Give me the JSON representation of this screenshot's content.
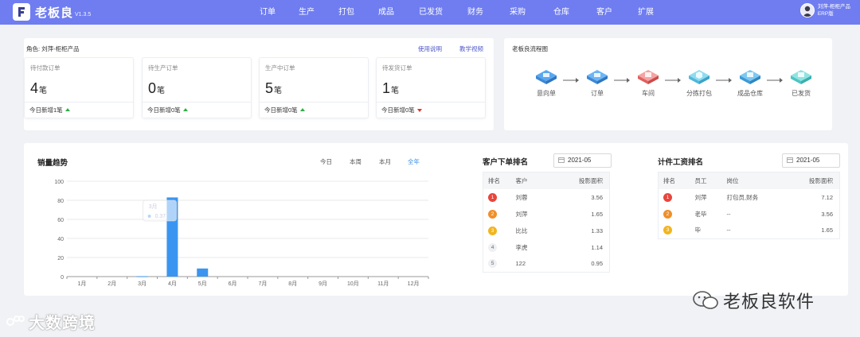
{
  "app": {
    "name": "老板良",
    "version": "V1.3.5",
    "accent": "#6f7df0"
  },
  "nav": [
    {
      "label": "订单"
    },
    {
      "label": "生产"
    },
    {
      "label": "打包"
    },
    {
      "label": "成品"
    },
    {
      "label": "已发货"
    },
    {
      "label": "财务"
    },
    {
      "label": "采购"
    },
    {
      "label": "仓库"
    },
    {
      "label": "客户"
    },
    {
      "label": "扩展"
    }
  ],
  "user": {
    "name": "刘萍-柜柜产品",
    "edition": "ERP版"
  },
  "role": {
    "text": "角色: 刘萍-柜柜产品",
    "help_link": "使用说明",
    "video_link": "教学视频"
  },
  "cards": [
    {
      "title": "待付款订单",
      "value": "4",
      "unit": "笔",
      "today": "今日新增1笔",
      "trend": "up"
    },
    {
      "title": "待生产订单",
      "value": "0",
      "unit": "笔",
      "today": "今日新增0笔",
      "trend": "up"
    },
    {
      "title": "生产中订单",
      "value": "5",
      "unit": "笔",
      "today": "今日新增0笔",
      "trend": "up"
    },
    {
      "title": "待发货订单",
      "value": "1",
      "unit": "笔",
      "today": "今日新增0笔",
      "trend": "down"
    }
  ],
  "flow": {
    "title": "老板良流程图",
    "steps": [
      {
        "label": "意向单",
        "icon": "intent-order-icon",
        "color": "#5aa7f0"
      },
      {
        "label": "订单",
        "icon": "order-icon",
        "color": "#5aa7f0"
      },
      {
        "label": "车间",
        "icon": "workshop-icon",
        "color": "#f06a6a"
      },
      {
        "label": "分拣打包",
        "icon": "packing-icon",
        "color": "#4fc4e8"
      },
      {
        "label": "成品仓库",
        "icon": "warehouse-icon",
        "color": "#4fb3e8"
      },
      {
        "label": "已发货",
        "icon": "shipped-icon",
        "color": "#4fd1d1"
      }
    ]
  },
  "sales": {
    "title": "销量趋势",
    "ranges": [
      "今日",
      "本周",
      "本月",
      "全年"
    ],
    "active_range": "全年",
    "tooltip": {
      "month": "3月",
      "value": "0.37"
    }
  },
  "chart_data": {
    "type": "bar",
    "title": "销量趋势",
    "categories": [
      "1月",
      "2月",
      "3月",
      "4月",
      "5月",
      "6月",
      "7月",
      "8月",
      "9月",
      "10月",
      "11月",
      "12月"
    ],
    "values": [
      0,
      0,
      0.37,
      83,
      8.5,
      0,
      0,
      0,
      0,
      0,
      0,
      0
    ],
    "yticks": [
      "0",
      "20",
      "40",
      "60",
      "80",
      "100"
    ],
    "ylim": [
      0,
      100
    ],
    "grid": true,
    "bar_color": "#3a95f0"
  },
  "customer_rank": {
    "title": "客户下单排名",
    "date": "2021-05",
    "headers": [
      "排名",
      "客户",
      "投影面积"
    ],
    "rows": [
      {
        "rank": "1",
        "name": "刘蓉",
        "value": "3.56"
      },
      {
        "rank": "2",
        "name": "刘萍",
        "value": "1.65"
      },
      {
        "rank": "3",
        "name": "比比",
        "value": "1.33"
      },
      {
        "rank": "4",
        "name": "李虎",
        "value": "1.14"
      },
      {
        "rank": "5",
        "name": "122",
        "value": "0.95"
      }
    ]
  },
  "wage_rank": {
    "title": "计件工资排名",
    "date": "2021-05",
    "headers": [
      "排名",
      "员工",
      "岗位",
      "投影面积"
    ],
    "rows": [
      {
        "rank": "1",
        "name": "刘萍",
        "post": "打包员,财务",
        "value": "7.12"
      },
      {
        "rank": "2",
        "name": "老毕",
        "post": "--",
        "value": "3.56"
      },
      {
        "rank": "3",
        "name": "毕",
        "post": "--",
        "value": "1.65"
      }
    ]
  },
  "watermarks": {
    "left": "大数跨境",
    "right": "老板良软件"
  }
}
